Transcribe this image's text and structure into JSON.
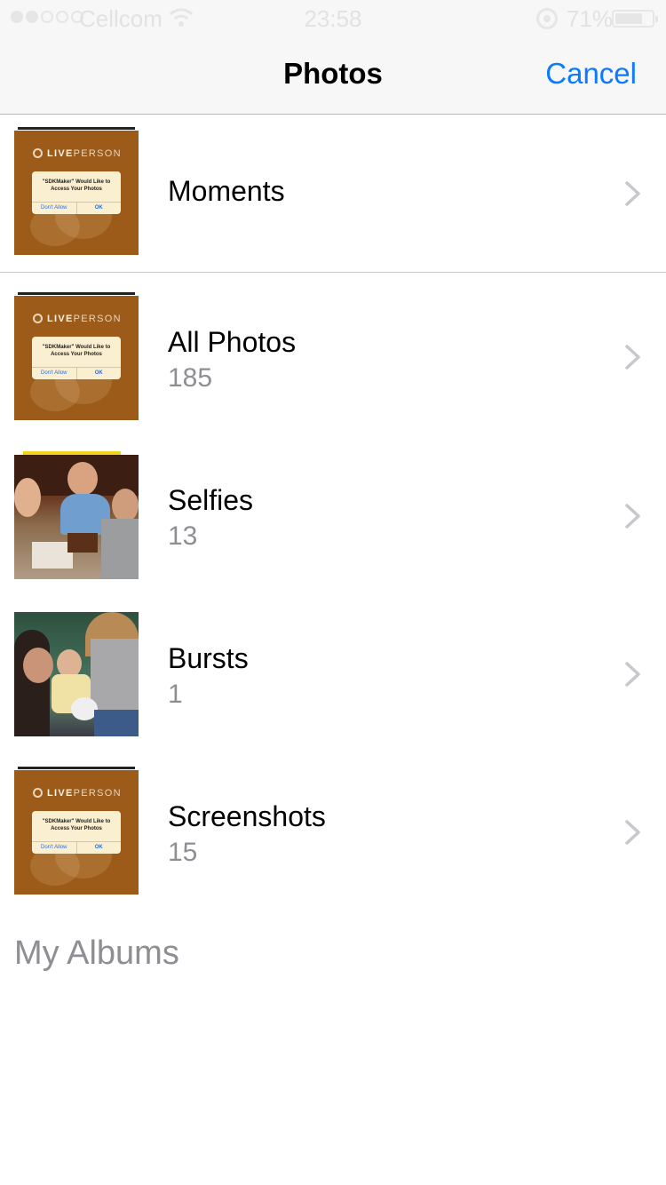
{
  "status_bar": {
    "carrier": "Cellcom",
    "time": "23:58",
    "battery_percent": "71%",
    "signal_bars_filled": 2,
    "signal_bars_total": 5
  },
  "nav": {
    "title": "Photos",
    "cancel_label": "Cancel"
  },
  "albums": [
    {
      "title": "Moments",
      "count": "",
      "thumbnail": "liveperson-screenshot"
    },
    {
      "title": "All Photos",
      "count": "185",
      "thumbnail": "liveperson-screenshot"
    },
    {
      "title": "Selfies",
      "count": "13",
      "thumbnail": "selfie-photo"
    },
    {
      "title": "Bursts",
      "count": "1",
      "thumbnail": "family-photo"
    },
    {
      "title": "Screenshots",
      "count": "15",
      "thumbnail": "liveperson-screenshot"
    }
  ],
  "thumbnail_text": {
    "brand_bold": "LIVE",
    "brand_rest": "PERSON",
    "dialog_message": "\"SDKMaker\" Would Like to\nAccess Your Photos",
    "dont_allow": "Don't Allow",
    "ok": "OK"
  },
  "sections": {
    "my_albums": "My Albums"
  },
  "colors": {
    "accent": "#0a7bff",
    "secondary_text": "#8e8e93",
    "thumbnail_brown": "#9c5b18"
  }
}
